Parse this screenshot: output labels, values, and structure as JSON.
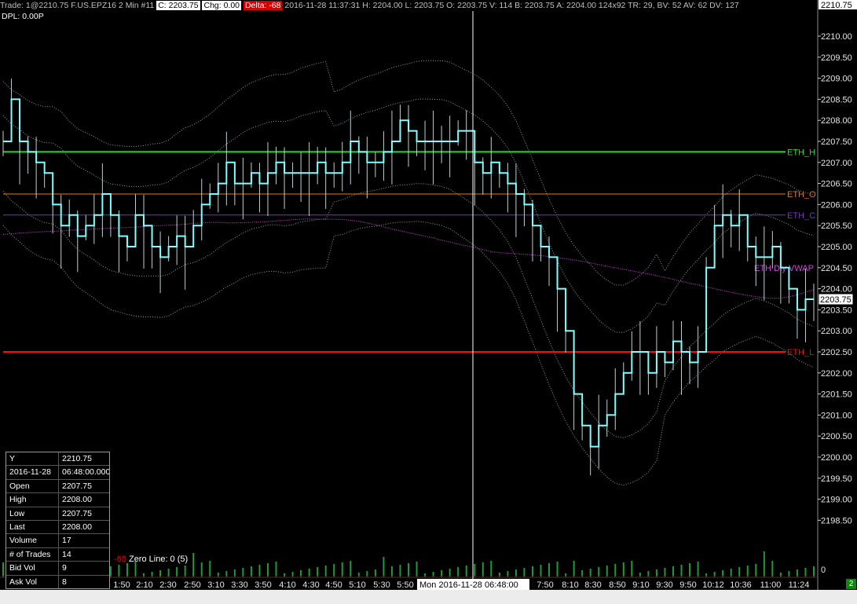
{
  "header": {
    "left_text": "Trade: 1@2210.75  F.US.EPZ16 2 Min  #11",
    "close_box": "C: 2203.75",
    "chg_box": "Chg: 0.00",
    "red_box": "Delta: -68",
    "right_text": "2016-11-28 11:37:31 H: 2204.00 L: 2203.75 O: 2203.75 V: 114 B: 2203.75 A: 2204.00 124x92 TR: 29, BV: 52 AV: 62 DV: 127",
    "dpl": "DPL: 0.00P"
  },
  "info_panel": [
    {
      "k": "Y",
      "v": "2210.75"
    },
    {
      "k": "2016-11-28",
      "v": "06:48:00.000"
    },
    {
      "k": "Open",
      "v": "2207.75"
    },
    {
      "k": "High",
      "v": "2208.00"
    },
    {
      "k": "Low",
      "v": "2207.75"
    },
    {
      "k": "Last",
      "v": "2208.00"
    },
    {
      "k": "Volume",
      "v": "17"
    },
    {
      "k": "# of Trades",
      "v": "14"
    },
    {
      "k": "Bid Vol",
      "v": "9"
    },
    {
      "k": "Ask Vol",
      "v": "8"
    }
  ],
  "volume_label": {
    "delta": "-68",
    "text": "Zero Line: 0  (5)"
  },
  "badge": "2",
  "colors": {
    "background": "#000000",
    "price_line": "#7fffff",
    "eth_h": "#22dd22",
    "eth_o": "#e07820",
    "eth_c": "#7a2fd0",
    "eth_l": "#ee1111",
    "vwap": "#c84ad4",
    "bands": "#9a9a9a",
    "volume": "#1f9a3a",
    "crosshair": "#ffffff"
  },
  "chart_data": {
    "type": "line",
    "symbol": "F.US.EPZ16",
    "y_ticks": [
      "2210.00",
      "2209.50",
      "2209.00",
      "2208.50",
      "2208.00",
      "2207.50",
      "2207.00",
      "2206.50",
      "2206.00",
      "2205.50",
      "2205.00",
      "2204.50",
      "2204.00",
      "2203.50",
      "2203.00",
      "2202.50",
      "2202.00",
      "2201.50",
      "2201.00",
      "2200.50",
      "2200.00",
      "2199.50",
      "2199.00",
      "2198.50"
    ],
    "ylim": [
      2198.2,
      2210.9
    ],
    "x_ticks": [
      "1:50",
      "2:10",
      "2:30",
      "2:50",
      "3:10",
      "3:30",
      "3:50",
      "4:10",
      "4:30",
      "4:50",
      "5:10",
      "5:30",
      "5:50",
      "7:50",
      "8:10",
      "8:30",
      "8:50",
      "9:10",
      "9:30",
      "9:50",
      "10:12",
      "10:36",
      "11:00",
      "11:24"
    ],
    "cursor_time": "Mon 2016-11-28  06:48:00",
    "cursor_y_label": "2210.75",
    "last_price_label": "2203.75",
    "levels": [
      {
        "name": "ETH_H",
        "value": 2207.25,
        "color": "#22dd22"
      },
      {
        "name": "ETH_O",
        "value": 2206.25,
        "color": "#e07820"
      },
      {
        "name": "ETH_C",
        "value": 2205.75,
        "color": "#7a2fd0"
      },
      {
        "name": "ETH_L",
        "value": 2202.5,
        "color": "#ee1111"
      }
    ],
    "vwap_label": "ETH Dly VWAP",
    "vwap_end": 2204.5,
    "price": [
      [
        0,
        2207.5
      ],
      [
        5,
        2208.5
      ],
      [
        10,
        2207.5
      ],
      [
        15,
        2207.25
      ],
      [
        20,
        2207.0
      ],
      [
        25,
        2206.75
      ],
      [
        30,
        2206.0
      ],
      [
        35,
        2205.5
      ],
      [
        40,
        2205.75
      ],
      [
        45,
        2205.25
      ],
      [
        50,
        2205.5
      ],
      [
        55,
        2205.75
      ],
      [
        60,
        2206.25
      ],
      [
        65,
        2205.75
      ],
      [
        70,
        2205.25
      ],
      [
        75,
        2205.0
      ],
      [
        80,
        2205.75
      ],
      [
        85,
        2205.5
      ],
      [
        90,
        2205.0
      ],
      [
        95,
        2204.75
      ],
      [
        100,
        2205.0
      ],
      [
        105,
        2205.25
      ],
      [
        110,
        2205.0
      ],
      [
        115,
        2205.5
      ],
      [
        120,
        2206.0
      ],
      [
        125,
        2206.25
      ],
      [
        130,
        2206.5
      ],
      [
        135,
        2207.0
      ],
      [
        140,
        2206.5
      ],
      [
        145,
        2206.5
      ],
      [
        150,
        2206.75
      ],
      [
        155,
        2206.5
      ],
      [
        160,
        2206.75
      ],
      [
        165,
        2207.0
      ],
      [
        170,
        2206.75
      ],
      [
        175,
        2206.75
      ],
      [
        180,
        2206.75
      ],
      [
        185,
        2206.75
      ],
      [
        190,
        2207.0
      ],
      [
        195,
        2206.75
      ],
      [
        200,
        2206.75
      ],
      [
        205,
        2207.0
      ],
      [
        210,
        2207.5
      ],
      [
        215,
        2207.25
      ],
      [
        220,
        2207.0
      ],
      [
        225,
        2207.0
      ],
      [
        230,
        2207.25
      ],
      [
        235,
        2207.5
      ],
      [
        240,
        2208.0
      ],
      [
        245,
        2207.75
      ],
      [
        250,
        2207.5
      ],
      [
        255,
        2207.5
      ],
      [
        260,
        2207.5
      ],
      [
        265,
        2207.5
      ],
      [
        270,
        2207.5
      ],
      [
        275,
        2207.75
      ],
      [
        280,
        2207.75
      ],
      [
        285,
        2207.0
      ],
      [
        290,
        2206.75
      ],
      [
        295,
        2207.0
      ],
      [
        300,
        2206.75
      ],
      [
        305,
        2206.5
      ],
      [
        310,
        2206.25
      ],
      [
        315,
        2206.0
      ],
      [
        320,
        2205.5
      ],
      [
        325,
        2205.0
      ],
      [
        330,
        2204.75
      ],
      [
        335,
        2204.0
      ],
      [
        340,
        2203.0
      ],
      [
        345,
        2201.5
      ],
      [
        350,
        2200.75
      ],
      [
        355,
        2200.25
      ],
      [
        360,
        2200.75
      ],
      [
        365,
        2201.0
      ],
      [
        370,
        2201.5
      ],
      [
        375,
        2202.0
      ],
      [
        380,
        2202.5
      ],
      [
        385,
        2202.5
      ],
      [
        390,
        2202.0
      ],
      [
        395,
        2202.5
      ],
      [
        400,
        2202.25
      ],
      [
        405,
        2202.75
      ],
      [
        410,
        2202.5
      ],
      [
        415,
        2202.25
      ],
      [
        420,
        2202.5
      ],
      [
        425,
        2204.5
      ],
      [
        430,
        2205.5
      ],
      [
        435,
        2205.75
      ],
      [
        440,
        2205.5
      ],
      [
        445,
        2205.75
      ],
      [
        450,
        2205.0
      ],
      [
        455,
        2204.75
      ],
      [
        460,
        2204.75
      ],
      [
        465,
        2205.0
      ],
      [
        470,
        2204.5
      ],
      [
        475,
        2204.0
      ],
      [
        480,
        2203.5
      ],
      [
        485,
        2203.75
      ],
      [
        490,
        2203.75
      ]
    ],
    "price_x_range": [
      0,
      490
    ],
    "volume_zero_line": 0
  }
}
